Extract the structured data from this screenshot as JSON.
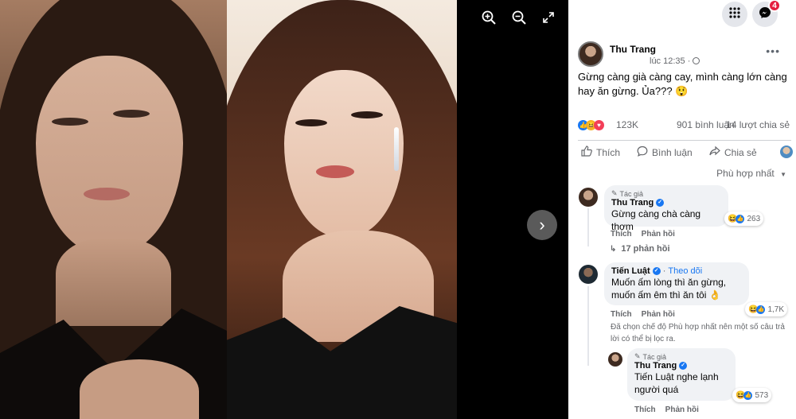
{
  "viewer": {
    "zoom_in_icon": "zoom-in-icon",
    "zoom_out_icon": "zoom-out-icon",
    "fullscreen_icon": "fullscreen-icon",
    "next_icon": "chevron-right-icon"
  },
  "topbar": {
    "menu_icon": "grid-menu-icon",
    "messenger_icon": "messenger-icon",
    "notification_count": "4"
  },
  "post": {
    "author": "Thu Trang",
    "time": "lúc 12:35 · ",
    "audience_icon": "globe-icon",
    "more": "•••",
    "text": "Gừng càng già càng cay, mình càng lớn càng hay ăn gừng. Ủa??? 😲",
    "reactions_count": "123K",
    "comments_count": "901 bình luận",
    "shares_count": "14 lượt chia sẻ",
    "like_label": "Thích",
    "comment_label": "Bình luận",
    "share_label": "Chia sẻ",
    "sort_label": "Phù hợp nhất"
  },
  "comments": [
    {
      "author_tag": "Tác giả",
      "name": "Thu Trang",
      "text": "Gừng càng chà càng thơm",
      "reaction_count": "263",
      "like": "Thích",
      "reply": "Phản hồi",
      "replies": "17 phản hồi"
    },
    {
      "name": "Tiến Luật",
      "follow": "Theo dõi",
      "text": "Muốn ấm lòng thì ăn gừng, muốn ấm êm thì ăn tôi 👌",
      "reaction_count": "1,7K",
      "like": "Thích",
      "reply": "Phản hồi",
      "note": "Đã chọn chế độ Phù hợp nhất nên một số câu trả lời có thể bị lọc ra."
    },
    {
      "author_tag": "Tác giả",
      "name": "Thu Trang",
      "text": "Tiến Luật nghe lạnh người quá",
      "reaction_count": "573",
      "like": "Thích",
      "reply": "Phản hồi"
    }
  ],
  "colors": {
    "brand_blue": "#1877f2",
    "badge_red": "#e41e3f",
    "bubble_gray": "#f0f2f5",
    "text_gray": "#65676b"
  }
}
